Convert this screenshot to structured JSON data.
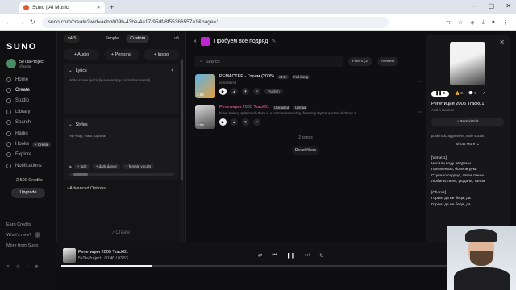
{
  "browser": {
    "tab_title": "Suno | AI Music",
    "url": "suno.com/create?wid=aebb009b-43be-4a17-95df-8f55366557a1&page=1"
  },
  "nav": {
    "logo": "SUNO",
    "profile_name": "5eTtaProject",
    "profile_handle": "@setta",
    "items": [
      {
        "label": "Home"
      },
      {
        "label": "Create"
      },
      {
        "label": "Studio"
      },
      {
        "label": "Library"
      },
      {
        "label": "Search"
      },
      {
        "label": "Radio"
      },
      {
        "label": "Hooks",
        "pill": "+ Create"
      },
      {
        "label": "Explore"
      },
      {
        "label": "Notifications"
      }
    ],
    "credits": "2 500 Credits",
    "upgrade": "Upgrade",
    "footer": [
      "Earn Credits",
      "What's new?",
      "More from Suno"
    ]
  },
  "create": {
    "version": "v4.5",
    "mode_simple": "Simple",
    "mode_custom": "Custom",
    "model": "v5",
    "btn_audio": "+ Audio",
    "btn_persona": "+ Persona",
    "btn_inspo": "+ Inspo",
    "lyrics_label": "Lyrics",
    "lyrics_placeholder": "Write some lyrics (leave empty for instrumental)",
    "styles_label": "Styles",
    "styles_value": "Hip-hop, R&B, upbeat",
    "tags": [
      "jazz",
      "dark dance",
      "female vocals"
    ],
    "advanced": "Advanced Options",
    "create_button": "Create"
  },
  "workspace": {
    "title": "Пробуем все подряд",
    "search_placeholder": "Search",
    "filters": "Filters (3)",
    "sort": "Newest",
    "songs": [
      {
        "title": "РЕМАСТЕР - Горим (2005)",
        "badge": "v4.5+",
        "extra": "Full Song",
        "subtitle": "remastered",
        "duration": "2:59",
        "action": "Publish"
      },
      {
        "title": "Репетиция 2005 Track01",
        "badge": "Uploaded",
        "extra": "Upload",
        "subtitle": "hi-hat leaking quite much there is a room reverberating, featuring rhythm section of drums and bass",
        "duration": "3:03",
        "action": ""
      }
    ],
    "count": "2 songs",
    "reset": "Reset filters"
  },
  "detail": {
    "plays": "6",
    "likes": "0",
    "comments": "0",
    "title": "Репетиция 2005 Track01",
    "caption": "Add a Caption",
    "remix": "Remix/Edit",
    "style": "punk rock, aggressive, male vocals",
    "show_more": "Show More",
    "lyrics": "[Verse 1]\nНосили воду вёдрами\nПрели носы, болели руки\nСтучало сердце, глаза синие\nЛюбили, пели, рыдали, таяли\n\n[Chorus]\nГорим, да не беда, да\nГорим, да не беда, да"
  },
  "player": {
    "title": "Репетиция 2005 Track01",
    "artist": "5eTtaProject",
    "time": "00:46 / 03:53",
    "progress": 0.2
  }
}
